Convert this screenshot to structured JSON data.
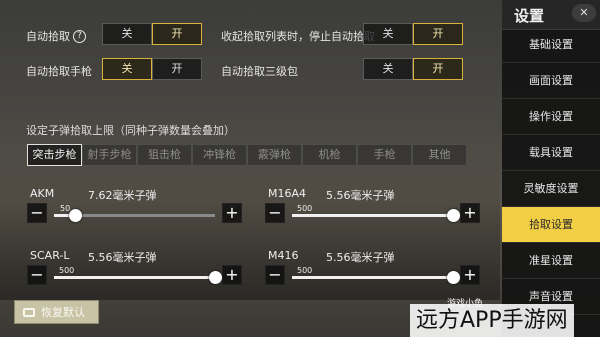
{
  "auto_pickup": {
    "label": "自动拾取",
    "help": "?",
    "options": [
      "关",
      "开"
    ],
    "selected": "开"
  },
  "collapse_pickup": {
    "label": "收起拾取列表时，停止自动拾取",
    "options": [
      "关",
      "开"
    ],
    "selected": "开"
  },
  "auto_pickup_pistol": {
    "label": "自动拾取手枪",
    "options": [
      "关",
      "开"
    ],
    "selected": "关"
  },
  "auto_pickup_lvl3_backpack": {
    "label": "自动拾取三级包",
    "options": [
      "关",
      "开"
    ],
    "selected": "开"
  },
  "ammo_section": {
    "title": "设定子弹拾取上限（同种子弹数量会叠加）",
    "tabs": [
      "突击步枪",
      "射手步枪",
      "狙击枪",
      "冲锋枪",
      "霰弹枪",
      "机枪",
      "手枪",
      "其他"
    ],
    "active_tab": "突击步枪",
    "weapons": [
      {
        "name": "AKM",
        "ammo": "7.62毫米子弹",
        "value": "50",
        "level": 0.13
      },
      {
        "name": "M16A4",
        "ammo": "5.56毫米子弹",
        "value": "500",
        "level": 1.0
      },
      {
        "name": "SCAR-L",
        "ammo": "5.56毫米子弹",
        "value": "500",
        "level": 1.0
      },
      {
        "name": "M416",
        "ammo": "5.56毫米子弹",
        "value": "500",
        "level": 1.0
      }
    ]
  },
  "reset_button": {
    "label": "恢复默认"
  },
  "sidebar": {
    "title": "设置",
    "close": "✕",
    "items": [
      "基础设置",
      "画面设置",
      "操作设置",
      "载具设置",
      "灵敏度设置",
      "拾取设置",
      "准星设置",
      "声音设置"
    ],
    "active": "拾取设置"
  },
  "watermark": {
    "small": "游戏小鱼",
    "large": "远方APP手游网"
  },
  "colors": {
    "accent": "#f2ce45",
    "toggle_on_border": "#d9b23a",
    "reset_bg": "#c9c3a6"
  }
}
